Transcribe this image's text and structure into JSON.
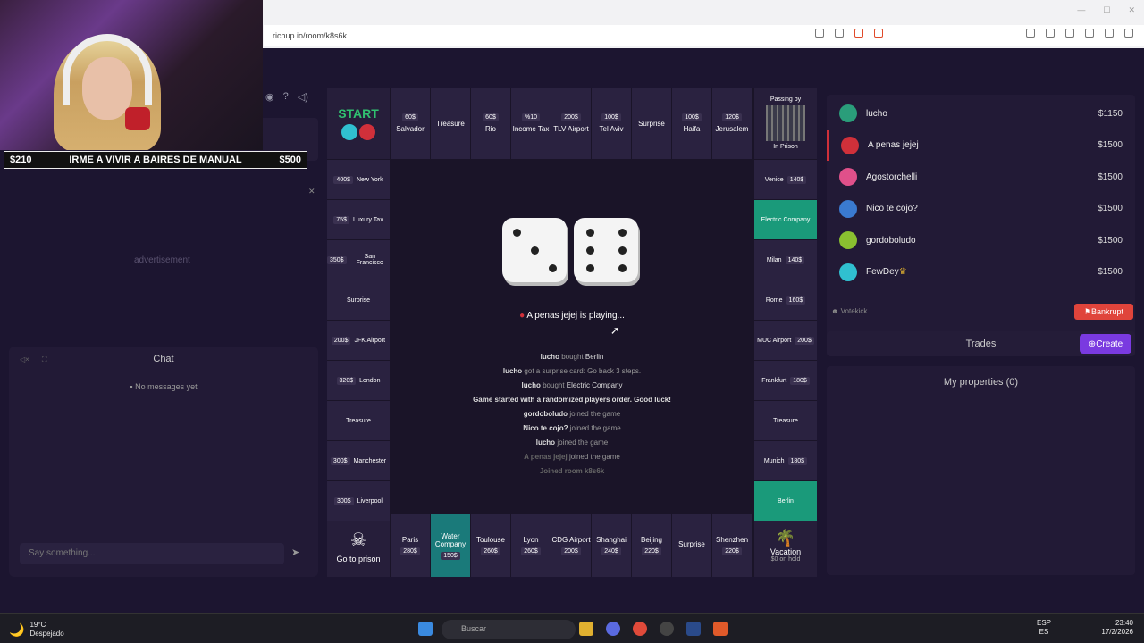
{
  "browser": {
    "url": "richup.io/room/k8s6k"
  },
  "ticker": {
    "left": "$210",
    "text": "IRME A VIVIR A BAIRES DE MANUAL",
    "right": "$500"
  },
  "sidebar": {
    "advertisement": "advertisement"
  },
  "chat": {
    "title": "Chat",
    "empty": "No messages yet",
    "placeholder": "Say something..."
  },
  "board": {
    "top": [
      {
        "name": "Salvador",
        "price": "60$"
      },
      {
        "name": "Treasure",
        "price": ""
      },
      {
        "name": "Rio",
        "price": "60$"
      },
      {
        "name": "Income Tax",
        "price": "%10"
      },
      {
        "name": "TLV Airport",
        "price": "200$"
      },
      {
        "name": "Tel Aviv",
        "price": "100$"
      },
      {
        "name": "Surprise",
        "price": ""
      },
      {
        "name": "Haifa",
        "price": "100$"
      },
      {
        "name": "Jerusalem",
        "price": "120$"
      }
    ],
    "corner_tr": {
      "top": "Passing by",
      "bottom": "In Prison"
    },
    "left": [
      {
        "name": "New York",
        "price": "400$"
      },
      {
        "name": "Luxury Tax",
        "price": "75$"
      },
      {
        "name": "San Francisco",
        "price": "350$"
      },
      {
        "name": "Surprise",
        "price": ""
      },
      {
        "name": "JFK Airport",
        "price": "200$"
      },
      {
        "name": "London",
        "price": "320$"
      },
      {
        "name": "Treasure",
        "price": ""
      },
      {
        "name": "Manchester",
        "price": "300$"
      },
      {
        "name": "Liverpool",
        "price": "300$"
      }
    ],
    "right": [
      {
        "name": "Venice",
        "price": "140$"
      },
      {
        "name": "Electric Company",
        "price": ""
      },
      {
        "name": "Milan",
        "price": "140$"
      },
      {
        "name": "Rome",
        "price": "160$"
      },
      {
        "name": "MUC Airport",
        "price": "200$"
      },
      {
        "name": "Frankfurt",
        "price": "180$"
      },
      {
        "name": "Treasure",
        "price": ""
      },
      {
        "name": "Munich",
        "price": "180$"
      },
      {
        "name": "Berlin",
        "price": ""
      }
    ],
    "bottom": [
      {
        "name": "Paris",
        "price": "280$"
      },
      {
        "name": "Water Company",
        "price": "150$"
      },
      {
        "name": "Toulouse",
        "price": "260$"
      },
      {
        "name": "Lyon",
        "price": "260$"
      },
      {
        "name": "CDG Airport",
        "price": "200$"
      },
      {
        "name": "Shanghai",
        "price": "240$"
      },
      {
        "name": "Beijing",
        "price": "220$"
      },
      {
        "name": "Surprise",
        "price": ""
      },
      {
        "name": "Shenzhen",
        "price": "220$"
      }
    ],
    "corner_bl": "Go to prison",
    "corner_br": {
      "title": "Vacation",
      "sub": "$0 on hold"
    }
  },
  "status": {
    "playing": "A penas jejej  is playing..."
  },
  "log": [
    {
      "who": "lucho",
      "what": "bought",
      "obj": "Berlin"
    },
    {
      "who": "lucho",
      "what": "got a surprise card: Go back 3 steps.",
      "obj": ""
    },
    {
      "who": "lucho",
      "what": "bought",
      "obj": "Electric Company"
    },
    {
      "who": "",
      "what": "Game started with a randomized players order. Good luck!",
      "obj": ""
    },
    {
      "who": "gordoboludo",
      "what": "joined the game",
      "obj": ""
    },
    {
      "who": "Nico te cojo?",
      "what": "joined the game",
      "obj": ""
    },
    {
      "who": "lucho",
      "what": "joined the game",
      "obj": ""
    },
    {
      "who": "A penas jejej",
      "what": "joined the game",
      "obj": ""
    },
    {
      "who": "",
      "what": "Joined room k8s6k",
      "obj": ""
    }
  ],
  "players": [
    {
      "name": "lucho",
      "money": "$1150",
      "color": "#2a9d7a"
    },
    {
      "name": "A penas jejej",
      "money": "$1500",
      "color": "#d0303a"
    },
    {
      "name": "Agostorchelli",
      "money": "$1500",
      "color": "#e0508a"
    },
    {
      "name": "Nico te cojo?",
      "money": "$1500",
      "color": "#3a7ad0"
    },
    {
      "name": "gordoboludo",
      "money": "$1500",
      "color": "#8ac030"
    },
    {
      "name": "FewDey",
      "money": "$1500",
      "color": "#30c0d0"
    }
  ],
  "actions": {
    "votekick": "Votekick",
    "bankrupt": "Bankrupt",
    "trades": "Trades",
    "create": "Create",
    "my_properties": "My properties (0)"
  },
  "taskbar": {
    "temp": "19°C",
    "weather": "Despejado",
    "search": "Buscar",
    "lang1": "ESP",
    "lang2": "ES",
    "time": "23:40",
    "date": "17/2/2026"
  }
}
